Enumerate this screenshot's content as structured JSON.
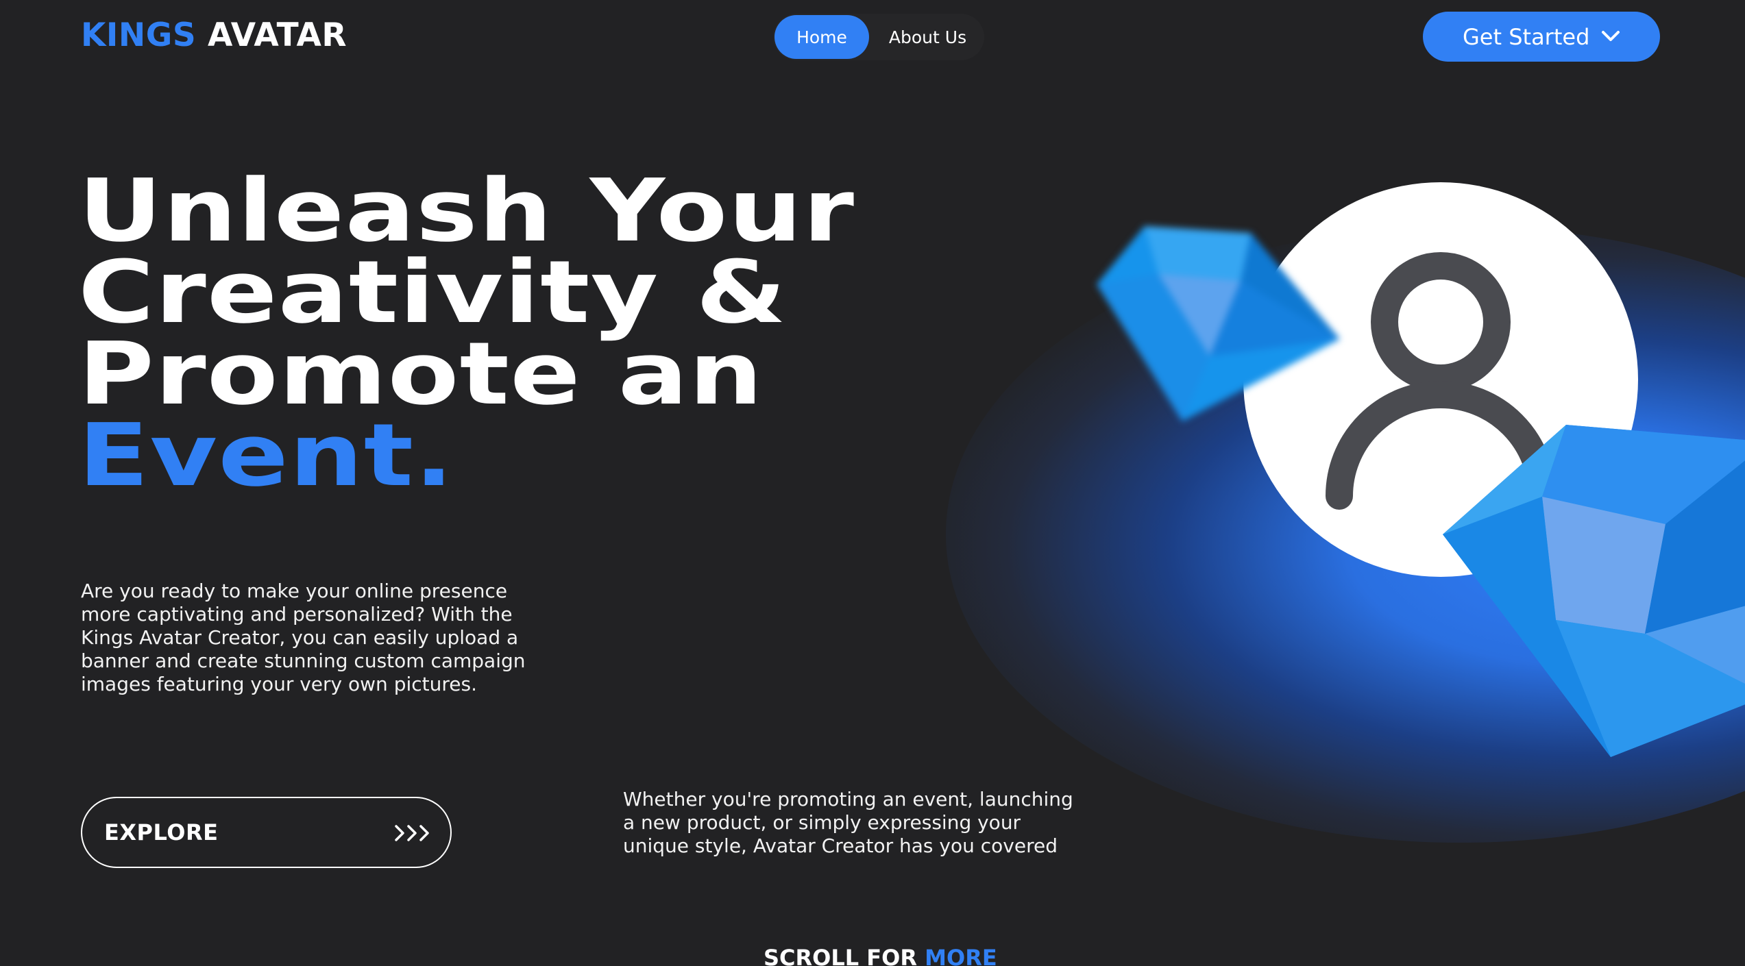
{
  "header": {
    "logo_accent": "KINGS",
    "logo_rest": "AVATAR",
    "nav": {
      "home": "Home",
      "about": "About Us"
    },
    "cta_label": "Get Started"
  },
  "hero": {
    "title_lines": [
      "Unleash Your",
      "Creativity &",
      "Promote an"
    ],
    "title_highlight": "Event.",
    "intro": "Are you ready to make your online presence more captivating and personalized? With the Kings Avatar Creator, you can easily upload a banner and create stunning custom campaign images featuring your very own pictures.",
    "explore_label": "EXPLORE",
    "explore_arrows": ">>>",
    "secondary": "Whether you're promoting an event, launching a new product, or simply expressing your unique style, Avatar Creator has you covered",
    "scroll_prefix": "SCROLL FOR",
    "scroll_highlight": "MORE"
  },
  "icons": {
    "dropdown": "chevron-down-icon",
    "explore": "triple-chevron-right-icon",
    "avatar": "user-icon",
    "decoration": "gem-icon"
  },
  "colors": {
    "accent": "#3180f4",
    "background": "#222224",
    "text": "#ffffff"
  }
}
